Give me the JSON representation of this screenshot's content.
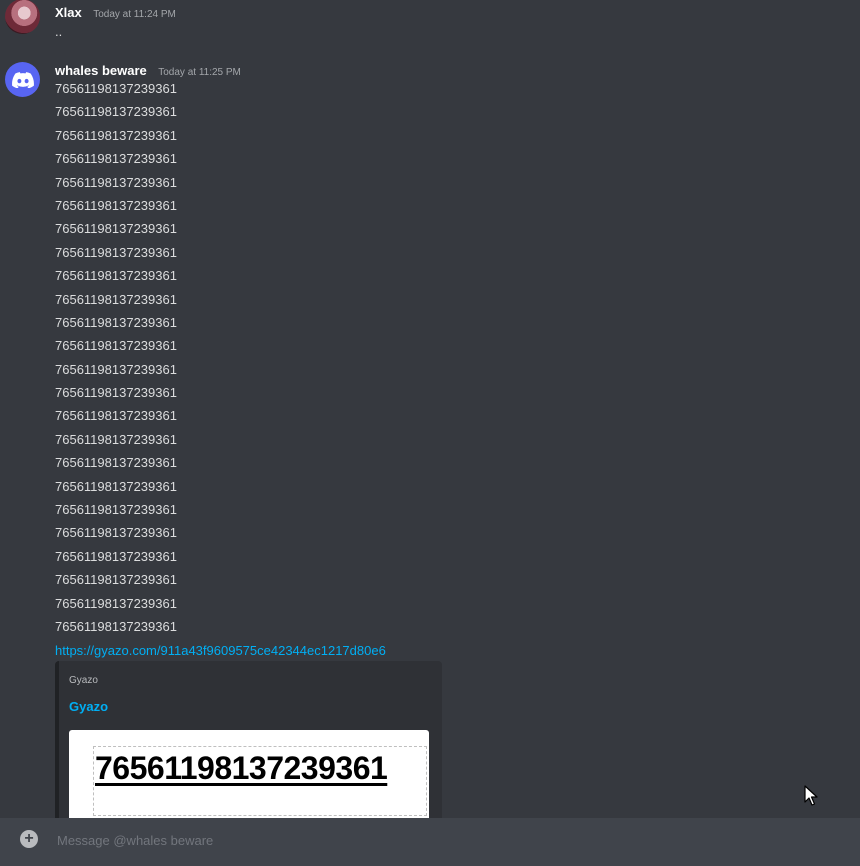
{
  "messages": [
    {
      "author": "Xlax",
      "timestamp": "Today at 11:24 PM",
      "lines": [
        ".."
      ]
    },
    {
      "author": "whales beware",
      "timestamp": "Today at 11:25 PM",
      "lines": [
        "76561198137239361",
        "76561198137239361",
        "76561198137239361",
        "76561198137239361",
        "76561198137239361",
        "76561198137239361",
        "76561198137239361",
        "76561198137239361",
        "76561198137239361",
        "76561198137239361",
        "76561198137239361",
        "76561198137239361",
        "76561198137239361",
        "76561198137239361",
        "76561198137239361",
        "76561198137239361",
        "76561198137239361",
        "76561198137239361",
        "76561198137239361",
        "76561198137239361",
        "76561198137239361",
        "76561198137239361",
        "76561198137239361",
        "76561198137239361"
      ],
      "link": "https://gyazo.com/911a43f9609575ce42344ec1217d80e6",
      "embed": {
        "provider": "Gyazo",
        "title": "Gyazo",
        "image_text": "76561198137239361"
      }
    }
  ],
  "composer": {
    "placeholder": "Message @whales beware",
    "value": ""
  },
  "colors": {
    "background": "#36393f",
    "link": "#00aff4",
    "discord_blurple": "#5865f2"
  },
  "icons": {
    "composer_add": "plus-circle-icon",
    "discord_avatar": "discord-logo-icon",
    "mouse_cursor": "mouse-cursor-icon"
  }
}
